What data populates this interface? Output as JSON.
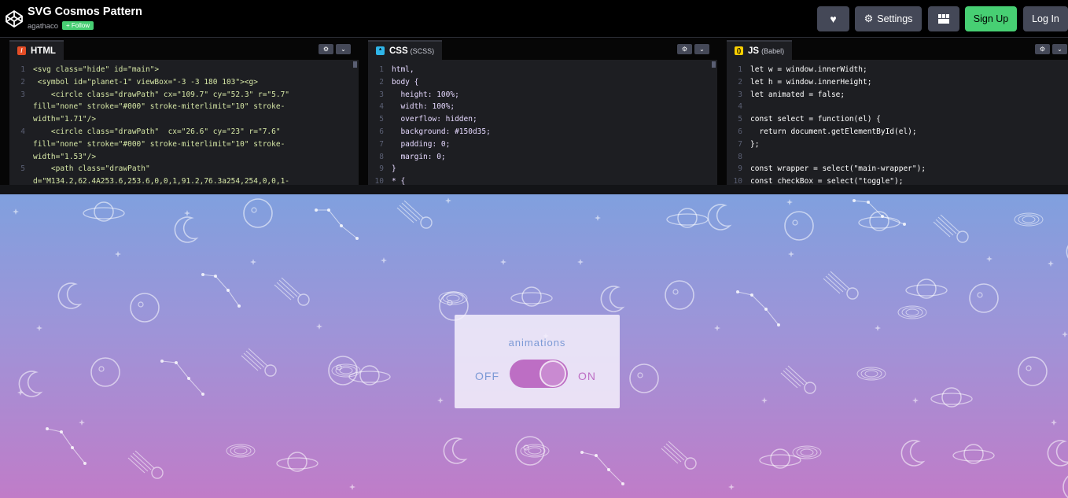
{
  "header": {
    "title": "SVG Cosmos Pattern",
    "author": "agathaco",
    "follow_label": "+ Follow",
    "settings_label": "Settings",
    "signup_label": "Sign Up",
    "login_label": "Log In"
  },
  "editors": {
    "html": {
      "title": "HTML",
      "lines": [
        {
          "n": "1",
          "t": "<svg class=\"hide\" id=\"main\">"
        },
        {
          "n": "2",
          "t": " <symbol id=\"planet-1\" viewBox=\"-3 -3 180 103\"><g>"
        },
        {
          "n": "3",
          "t": "    <circle class=\"drawPath\" cx=\"109.7\" cy=\"52.3\" r=\"5.7\""
        },
        {
          "n": "",
          "t": "fill=\"none\" stroke=\"#000\" stroke-miterlimit=\"10\" stroke-"
        },
        {
          "n": "",
          "t": "width=\"1.71\"/>"
        },
        {
          "n": "4",
          "t": "    <circle class=\"drawPath\"  cx=\"26.6\" cy=\"23\" r=\"7.6\""
        },
        {
          "n": "",
          "t": "fill=\"none\" stroke=\"#000\" stroke-miterlimit=\"10\" stroke-"
        },
        {
          "n": "",
          "t": "width=\"1.53\"/>"
        },
        {
          "n": "5",
          "t": "    <path class=\"drawPath\""
        },
        {
          "n": "",
          "t": "d=\"M134.2,62.4A253.6,253.6,0,0,1,91.2,76.3a254,254,0,0,1-"
        }
      ]
    },
    "css": {
      "title": "CSS",
      "subtitle": "(SCSS)",
      "lines": [
        {
          "n": "1",
          "t": "html,"
        },
        {
          "n": "2",
          "t": "body {"
        },
        {
          "n": "3",
          "t": "  height: 100%;"
        },
        {
          "n": "4",
          "t": "  width: 100%;"
        },
        {
          "n": "5",
          "t": "  overflow: hidden;"
        },
        {
          "n": "6",
          "t": "  background: #150d35;"
        },
        {
          "n": "7",
          "t": "  padding: 0;"
        },
        {
          "n": "8",
          "t": "  margin: 0;"
        },
        {
          "n": "9",
          "t": "}"
        },
        {
          "n": "10",
          "t": "* {"
        }
      ]
    },
    "js": {
      "title": "JS",
      "subtitle": "(Babel)",
      "lines": [
        {
          "n": "1",
          "t": "let w = window.innerWidth;"
        },
        {
          "n": "2",
          "t": "let h = window.innerHeight;"
        },
        {
          "n": "3",
          "t": "let animated = false;"
        },
        {
          "n": "4",
          "t": ""
        },
        {
          "n": "5",
          "t": "const select = function(el) {"
        },
        {
          "n": "6",
          "t": "  return document.getElementById(el);"
        },
        {
          "n": "7",
          "t": "};"
        },
        {
          "n": "8",
          "t": ""
        },
        {
          "n": "9",
          "t": "const wrapper = select(\"main-wrapper\");"
        },
        {
          "n": "10",
          "t": "const checkBox = select(\"toggle\");"
        }
      ]
    }
  },
  "preview": {
    "animations_label": "animations",
    "off_label": "OFF",
    "on_label": "ON",
    "toggle_on": true
  },
  "colors": {
    "accent_green": "#47cf73",
    "toggle_pink": "#bd6ec4",
    "label_blue": "#7d9ad6"
  }
}
